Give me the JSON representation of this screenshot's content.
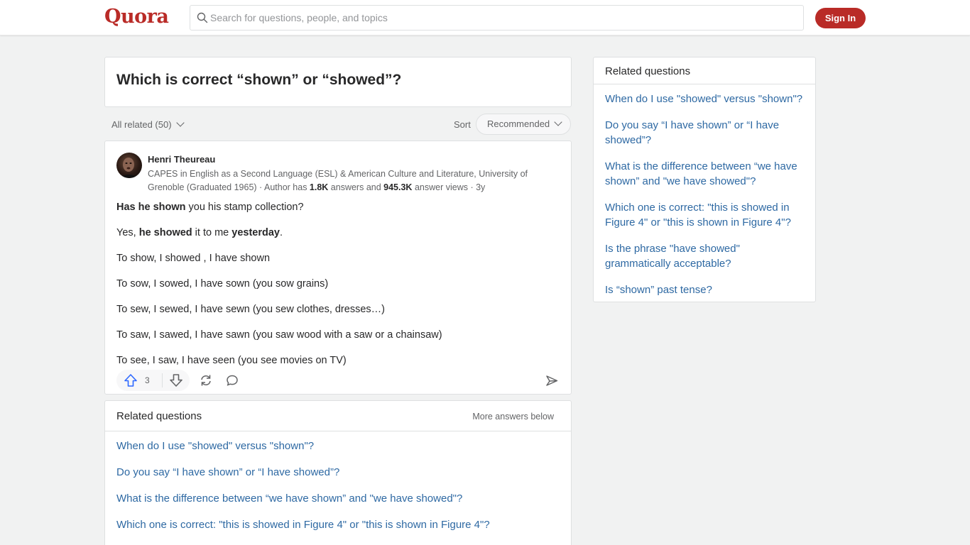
{
  "header": {
    "logo": "Quora",
    "search_placeholder": "Search for questions, people, and topics",
    "signin_label": "Sign In"
  },
  "question": {
    "title": "Which is correct “shown” or “showed”?"
  },
  "filters": {
    "all_related": "All related (50)",
    "sort_label": "Sort",
    "sort_value": "Recommended"
  },
  "answer": {
    "author_name": "Henri Theureau",
    "credential_text": "CAPES in English as a Second Language (ESL) & American Culture and Literature, University of Grenoble (Graduated 1965) · Author has ",
    "answers_count": "1.8K",
    "answers_label": " answers and ",
    "views_count": "945.3K",
    "views_label": " answer views · 3y",
    "lines": {
      "l1_bold": "Has he shown",
      "l1_rest": " you his stamp collection?",
      "l2_a": "Yes, ",
      "l2_bold1": "he showed",
      "l2_mid": " it to me ",
      "l2_bold2": "yesterday",
      "l2_end": ".",
      "l3": "To show, I showed , I have shown",
      "l4": "To sow, I sowed, I have sown (you sow grains)",
      "l5": "To sew, I sewed, I have sewn (you sew clothes, dresses…)",
      "l6": "To saw, I sawed, I have sawn (you saw wood with a saw or a chainsaw)",
      "l7": "To see, I saw, I have seen (you see movies on TV)"
    },
    "upvotes": "3"
  },
  "related_inline": {
    "title": "Related questions",
    "more": "More answers below",
    "items": [
      "When do I use \"showed\" versus \"shown\"?",
      "Do you say “I have shown” or “I have showed”?",
      "What is the difference between “we have shown” and \"we have showed\"?",
      "Which one is correct: \"this is showed in Figure 4\" or \"this is shown in Figure 4\"?"
    ]
  },
  "related_side": {
    "title": "Related questions",
    "items": [
      "When do I use \"showed\" versus \"shown\"?",
      "Do you say “I have shown” or “I have showed”?",
      "What is the difference between “we have shown” and \"we have showed\"?",
      "Which one is correct: \"this is showed in Figure 4\" or \"this is shown in Figure 4\"?",
      "Is the phrase \"have showed\" grammatically acceptable?",
      "Is “shown” past tense?"
    ]
  },
  "colors": {
    "brand": "#b92b27",
    "link": "#2e69a3",
    "upvote": "#2e69ff"
  }
}
